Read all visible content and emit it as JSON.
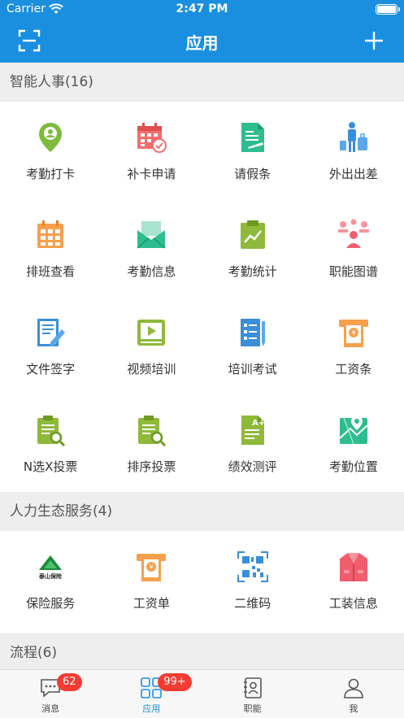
{
  "status": {
    "carrier": "Carrier",
    "time": "2:47 PM"
  },
  "nav": {
    "title": "应用",
    "left_icon": "scan-icon",
    "right_icon": "plus-icon"
  },
  "colors": {
    "primary": "#1a8fe0",
    "badge": "#f43c32"
  },
  "sections": [
    {
      "title": "智能人事(16)",
      "items": [
        {
          "label": "考勤打卡",
          "icon": "location-pin-icon"
        },
        {
          "label": "补卡申请",
          "icon": "calendar-check-icon"
        },
        {
          "label": "请假条",
          "icon": "document-pen-icon"
        },
        {
          "label": "外出出差",
          "icon": "traveler-luggage-icon"
        },
        {
          "label": "排班查看",
          "icon": "schedule-grid-icon"
        },
        {
          "label": "考勤信息",
          "icon": "envelope-icon"
        },
        {
          "label": "考勤统计",
          "icon": "clipboard-chart-icon"
        },
        {
          "label": "职能图谱",
          "icon": "org-chart-icon"
        },
        {
          "label": "文件签字",
          "icon": "document-sign-icon"
        },
        {
          "label": "视频培训",
          "icon": "video-play-icon"
        },
        {
          "label": "培训考试",
          "icon": "exam-sheet-icon"
        },
        {
          "label": "工资条",
          "icon": "payslip-icon"
        },
        {
          "label": "N选X投票",
          "icon": "clipboard-search-icon"
        },
        {
          "label": "排序投票",
          "icon": "clipboard-search-icon"
        },
        {
          "label": "绩效测评",
          "icon": "document-grade-icon"
        },
        {
          "label": "考勤位置",
          "icon": "map-pin-icon"
        }
      ]
    },
    {
      "title": "人力生态服务(4)",
      "items": [
        {
          "label": "保险服务",
          "icon": "taishan-insurance-logo",
          "logo_text": "泰山保险"
        },
        {
          "label": "工资单",
          "icon": "payslip-icon"
        },
        {
          "label": "二维码",
          "icon": "qr-code-icon"
        },
        {
          "label": "工装信息",
          "icon": "uniform-icon"
        }
      ]
    },
    {
      "title": "流程(6)"
    }
  ],
  "tabs": [
    {
      "label": "消息",
      "badge": "62",
      "icon": "chat-bubble-icon"
    },
    {
      "label": "应用",
      "badge": "99+",
      "icon": "apps-grid-icon",
      "active": true
    },
    {
      "label": "职能",
      "icon": "contact-book-icon"
    },
    {
      "label": "我",
      "icon": "person-icon"
    }
  ]
}
